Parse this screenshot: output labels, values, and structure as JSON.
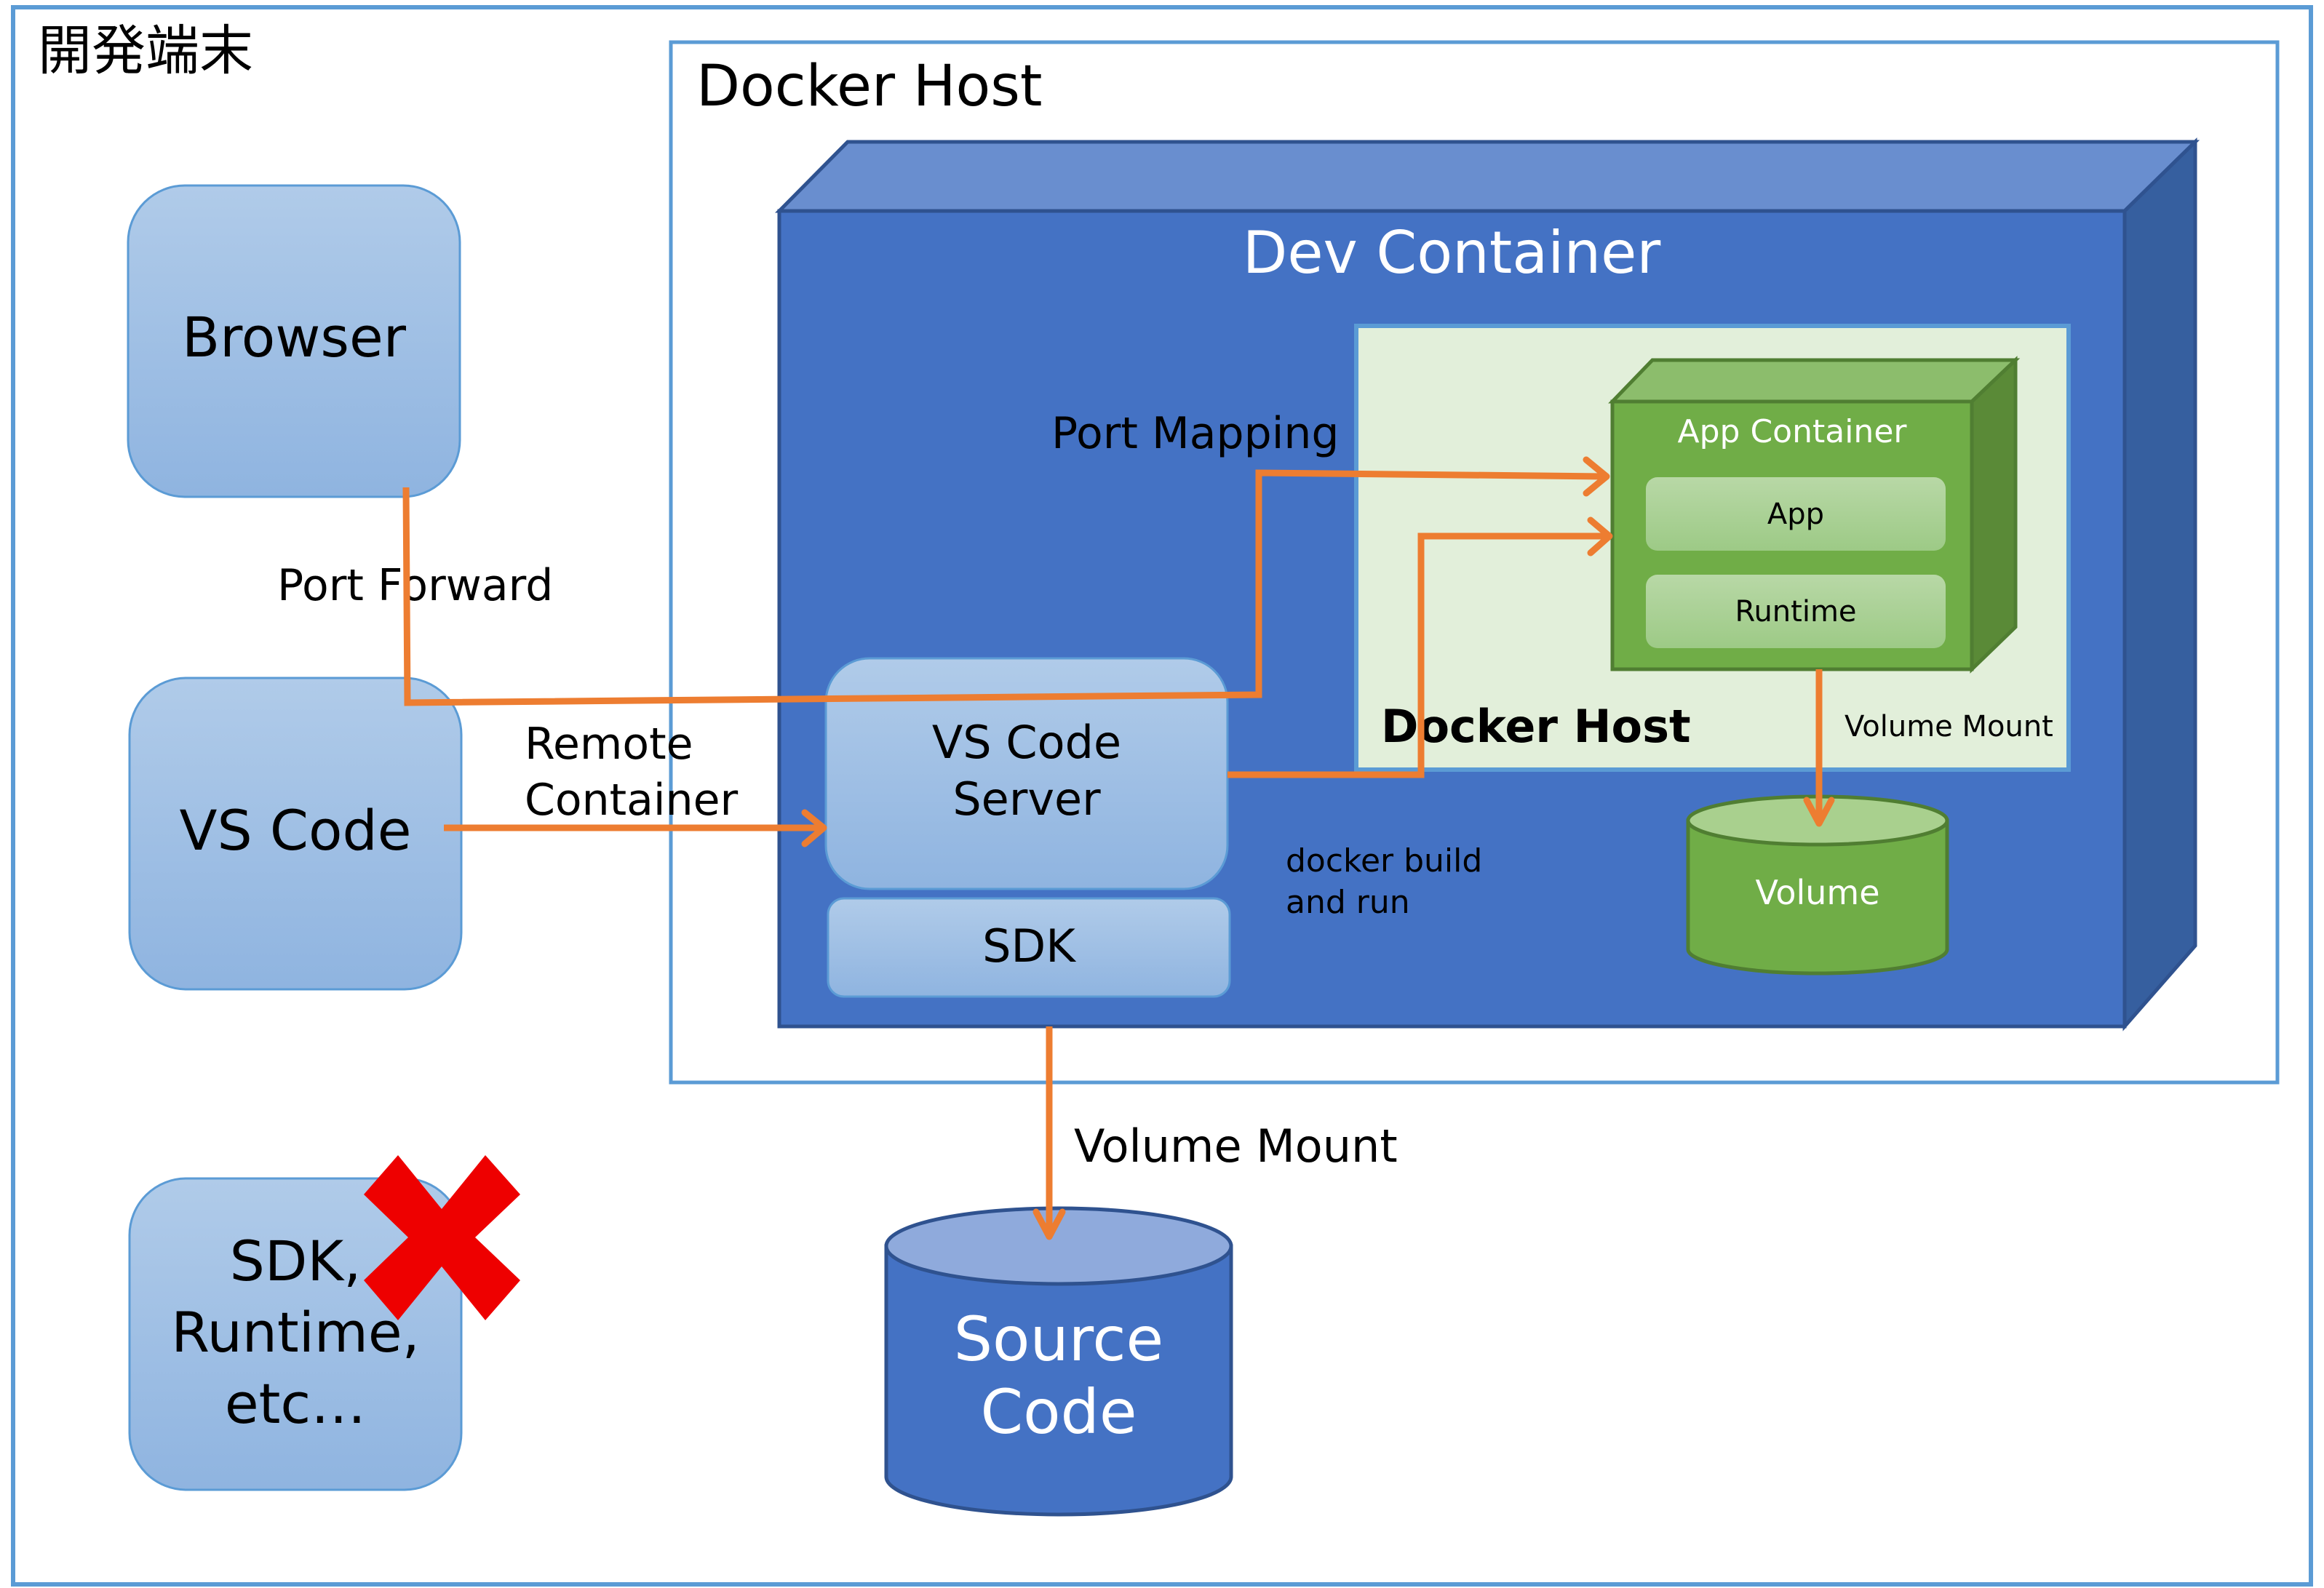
{
  "frame": {
    "title": "開発端末"
  },
  "docker_host_outer": {
    "title": "Docker Host"
  },
  "dev_container": {
    "title": "Dev Container",
    "vscode_server": {
      "line1": "VS Code",
      "line2": "Server"
    },
    "sdk": "SDK",
    "docker_build_label": {
      "line1": "docker build",
      "line2": "and run"
    },
    "port_mapping_label": "Port Mapping",
    "inner_docker_host": {
      "title": "Docker Host",
      "volume_mount_label": "Volume Mount",
      "app_container": {
        "title": "App Container",
        "layers": [
          "App",
          "Runtime"
        ]
      }
    },
    "volume": "Volume"
  },
  "local_tools": {
    "browser": "Browser",
    "vscode": "VS Code",
    "sdk_runtime": {
      "line1": "SDK,",
      "line2": "Runtime,",
      "line3": "etc…"
    },
    "excluded_marker": "red-x-icon"
  },
  "connections": {
    "port_forward": "Port Forward",
    "remote_container": {
      "line1": "Remote",
      "line2": "Container"
    },
    "volume_mount": "Volume Mount"
  },
  "source_code": {
    "line1": "Source",
    "line2": "Code"
  },
  "colors": {
    "frame_border": "#5B9BD5",
    "dev_container_front": "#4472C4",
    "dev_container_top": "#698ECF",
    "dev_container_side": "#365F9F",
    "inner_host_fill": "#E2EFDA",
    "app_container": "#70AD47",
    "app_container_top": "#8CBD6C",
    "app_container_side": "#5A8A37",
    "arrow": "#ED7D31",
    "light_box": "#A4C2E6",
    "red_x": "#EE0000"
  }
}
